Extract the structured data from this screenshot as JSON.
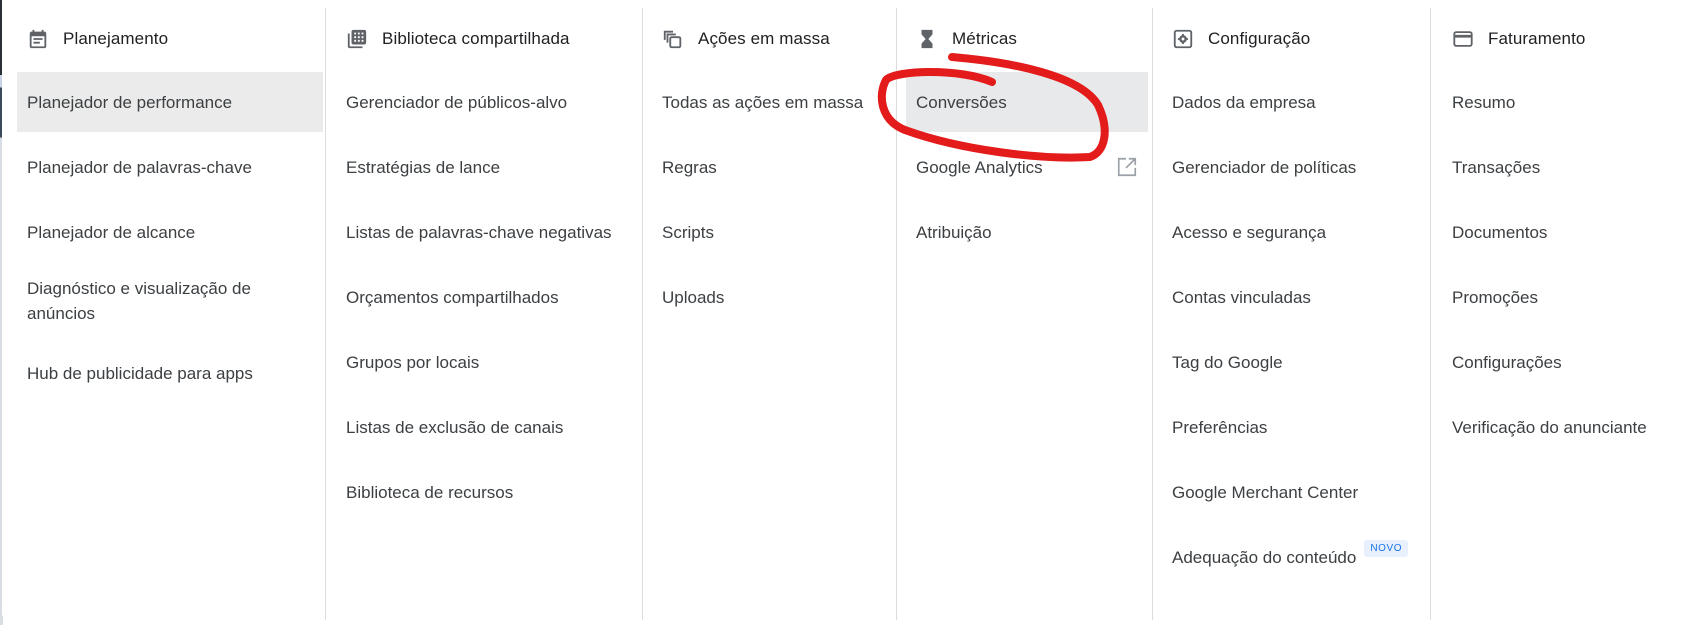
{
  "columns": [
    {
      "title": "Planejamento",
      "icon": "calendar-icon",
      "items": [
        {
          "label": "Planejador de performance",
          "active": true
        },
        {
          "label": "Planejador de palavras-chave"
        },
        {
          "label": "Planejador de alcance"
        },
        {
          "label": "Diagnóstico e visualização de anúncios"
        },
        {
          "label": "Hub de publicidade para apps"
        }
      ]
    },
    {
      "title": "Biblioteca compartilhada",
      "icon": "library-icon",
      "items": [
        {
          "label": "Gerenciador de públicos-alvo"
        },
        {
          "label": "Estratégias de lance"
        },
        {
          "label": "Listas de palavras-chave negativas"
        },
        {
          "label": "Orçamentos compartilhados"
        },
        {
          "label": "Grupos por locais"
        },
        {
          "label": "Listas de exclusão de canais"
        },
        {
          "label": "Biblioteca de recursos"
        }
      ]
    },
    {
      "title": "Ações em massa",
      "icon": "bulk-actions-icon",
      "items": [
        {
          "label": "Todas as ações em massa"
        },
        {
          "label": "Regras"
        },
        {
          "label": "Scripts"
        },
        {
          "label": "Uploads"
        }
      ]
    },
    {
      "title": "Métricas",
      "icon": "hourglass-icon",
      "items": [
        {
          "label": "Conversões",
          "active": true
        },
        {
          "label": "Google Analytics",
          "external": true
        },
        {
          "label": "Atribuição"
        }
      ]
    },
    {
      "title": "Configuração",
      "icon": "settings-icon",
      "items": [
        {
          "label": "Dados da empresa"
        },
        {
          "label": "Gerenciador de políticas"
        },
        {
          "label": "Acesso e segurança"
        },
        {
          "label": "Contas vinculadas"
        },
        {
          "label": "Tag do Google"
        },
        {
          "label": "Preferências"
        },
        {
          "label": "Google Merchant Center"
        },
        {
          "label": "Adequação do conteúdo",
          "badge": "NOVO"
        }
      ]
    },
    {
      "title": "Faturamento",
      "icon": "billing-card-icon",
      "items": [
        {
          "label": "Resumo"
        },
        {
          "label": "Transações"
        },
        {
          "label": "Documentos"
        },
        {
          "label": "Promoções"
        },
        {
          "label": "Configurações"
        },
        {
          "label": "Verificação do anunciante"
        }
      ]
    }
  ],
  "colors": {
    "annotation": "#e31b1b",
    "badge_bg": "#e8f0fe",
    "badge_text": "#1a73e8",
    "active_row": "#ebebeb"
  }
}
